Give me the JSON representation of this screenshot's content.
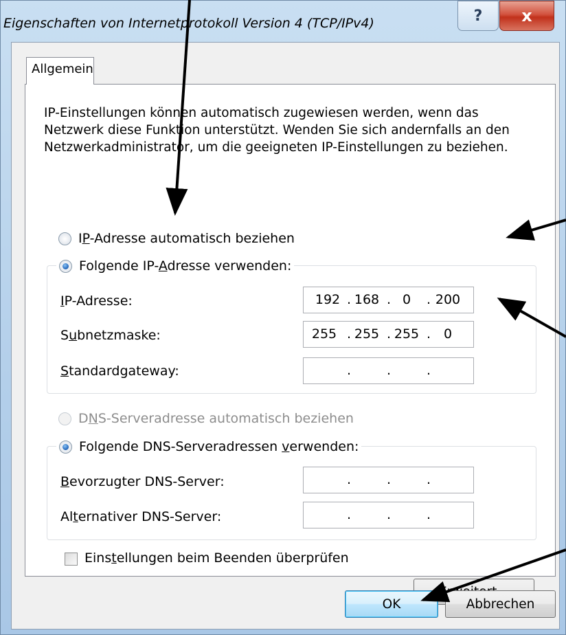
{
  "window": {
    "title": "Eigenschaften von Internetprotokoll Version 4 (TCP/IPv4)",
    "help_glyph": "?",
    "close_glyph": "x"
  },
  "tabs": [
    {
      "label": "Allgemein",
      "selected": true
    }
  ],
  "intro_text": "IP-Einstellungen können automatisch zugewiesen werden, wenn das Netzwerk diese Funktion unterstützt. Wenden Sie sich andernfalls an den Netzwerkadministrator, um die geeigneten IP-Einstellungen zu beziehen.",
  "ip_mode": {
    "auto": {
      "pre": "I",
      "key": "P",
      "post": "-Adresse automatisch beziehen",
      "selected": false
    },
    "manual": {
      "pre": "Folgende IP-",
      "key": "A",
      "post": "dresse verwenden:",
      "selected": true
    }
  },
  "ip_fields": [
    {
      "pre": "",
      "key": "I",
      "post": "P-Adresse:",
      "octets": [
        "192",
        "168",
        "0",
        "200"
      ]
    },
    {
      "pre": "S",
      "key": "u",
      "post": "bnetzmaske:",
      "octets": [
        "255",
        "255",
        "255",
        "0"
      ]
    },
    {
      "pre": "",
      "key": "S",
      "post": "tandardgateway:",
      "octets": [
        "",
        "",
        "",
        ""
      ]
    }
  ],
  "dns_mode": {
    "auto": {
      "pre": "D",
      "key": "N",
      "post": "S-Serveradresse automatisch beziehen",
      "selected": false,
      "disabled": true
    },
    "manual": {
      "pre": "Folgende DNS-Serveradressen ",
      "key": "v",
      "post": "erwenden:",
      "selected": true
    }
  },
  "dns_fields": [
    {
      "pre": "",
      "key": "B",
      "post": "evorzugter DNS-Server:",
      "octets": [
        "",
        "",
        "",
        ""
      ]
    },
    {
      "pre": "Al",
      "key": "t",
      "post": "ernativer DNS-Server:",
      "octets": [
        "",
        "",
        "",
        ""
      ]
    }
  ],
  "validate_on_exit": {
    "pre": "Eins",
    "key": "t",
    "post": "ellungen beim Beenden überprüfen",
    "checked": false
  },
  "buttons": {
    "advanced": {
      "pre": "",
      "key": "E",
      "post": "rweitert..."
    },
    "ok": "OK",
    "cancel": "Abbrechen"
  },
  "colors": {
    "radio_selected": "#2c6fc0",
    "ok_button_highlight": "#48c6f7",
    "annotation_arrow": "#000000"
  }
}
